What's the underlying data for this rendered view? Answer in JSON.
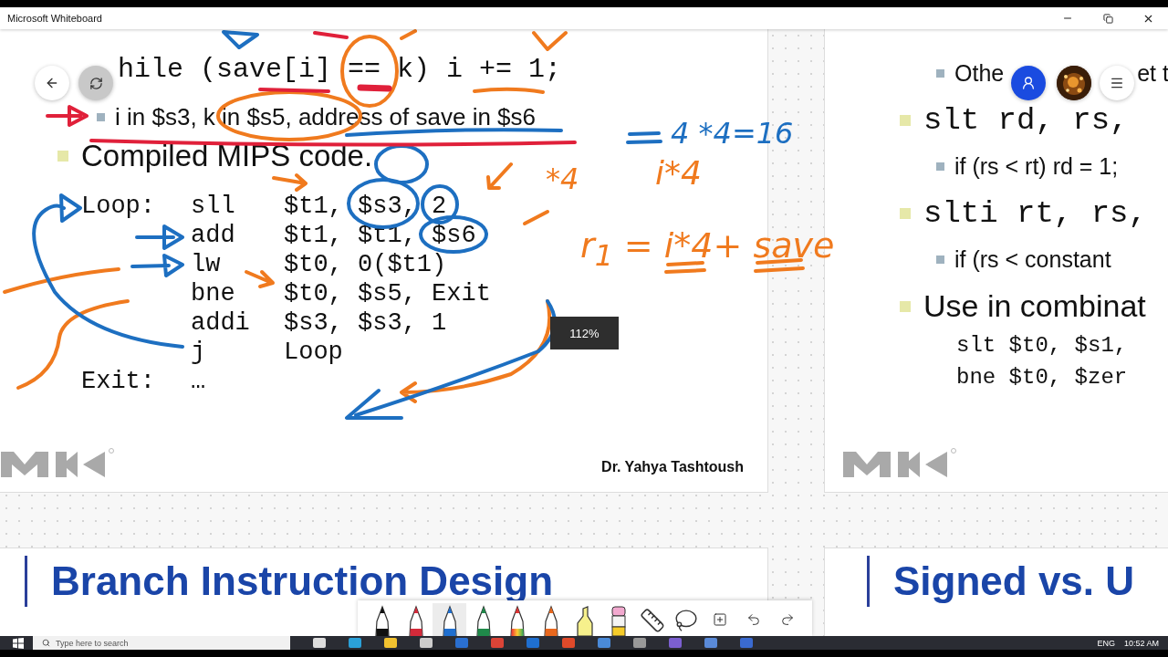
{
  "window": {
    "title": "Microsoft Whiteboard"
  },
  "main_slide": {
    "statement": "hile (save[i] == k) i += 1;",
    "bullets": [
      {
        "kind": "sub",
        "text": "i in $s3, k in $s5, address of save in $s6"
      },
      {
        "kind": "main",
        "text": "Compiled MIPS code."
      }
    ],
    "code": [
      {
        "label": "Loop:",
        "op": "sll",
        "args": "$t1, $s3, 2"
      },
      {
        "op": "add",
        "args": "$t1, $t1, $s6"
      },
      {
        "op": "lw",
        "args": "$t0, 0($t1)"
      },
      {
        "op": "bne",
        "args": "$t0, $s5, Exit"
      },
      {
        "op": "addi",
        "args": "$s3, $s3, 1"
      },
      {
        "op": "j",
        "args": "Loop"
      },
      {
        "label": "Exit:",
        "op": "…"
      }
    ],
    "author": "Dr. Yahya Tashtoush"
  },
  "annotations": [
    {
      "text": "4 *4=16",
      "color": "#1d6fc1"
    },
    {
      "text": "*4",
      "color": "#f07a1e"
    },
    {
      "text": "i*4",
      "color": "#f07a1e"
    },
    {
      "text": "r$_{1}$ = i*4+ save",
      "color": "#f07a1e"
    }
  ],
  "side_slide": {
    "lines": [
      {
        "kind": "sub",
        "text": "Othe",
        "tail": "et t"
      },
      {
        "kind": "code",
        "text": "slt rd, rs,"
      },
      {
        "kind": "sub",
        "text": "if (rs < rt) rd = 1;"
      },
      {
        "kind": "code",
        "text": "slti rt, rs,"
      },
      {
        "kind": "sub",
        "text": "if (rs < constant"
      },
      {
        "kind": "main",
        "text": "Use in combinat"
      },
      {
        "kind": "snippet",
        "text": "slt $t0, $s1,"
      },
      {
        "kind": "snippet",
        "text": "bne $t0, $zer"
      }
    ]
  },
  "zoom_badge": "112%",
  "bottom_slides": [
    {
      "title": "Branch Instruction Design"
    },
    {
      "title": "Signed vs. U"
    }
  ],
  "toolbar": {
    "tools": [
      {
        "kind": "pen",
        "color": "#111111",
        "selected": false
      },
      {
        "kind": "pen",
        "color": "#d42a3a",
        "selected": false
      },
      {
        "kind": "pen",
        "color": "#1f6fd0",
        "selected": true
      },
      {
        "kind": "pen",
        "color": "#1f8a4a",
        "selected": false
      },
      {
        "kind": "rainbow_pen",
        "selected": false
      },
      {
        "kind": "pen",
        "color": "#e8681e",
        "selected": false
      },
      {
        "kind": "highlighter",
        "color": "#f6f08c",
        "selected": false
      },
      {
        "kind": "eraser",
        "selected": false
      },
      {
        "kind": "ruler",
        "selected": false
      },
      {
        "kind": "lasso",
        "selected": false
      },
      {
        "kind": "add",
        "selected": false
      },
      {
        "kind": "undo",
        "selected": false
      },
      {
        "kind": "redo",
        "selected": false
      }
    ]
  },
  "taskbar": {
    "search_placeholder": "Type here to search",
    "language": "ENG",
    "time": "10:52 AM"
  }
}
